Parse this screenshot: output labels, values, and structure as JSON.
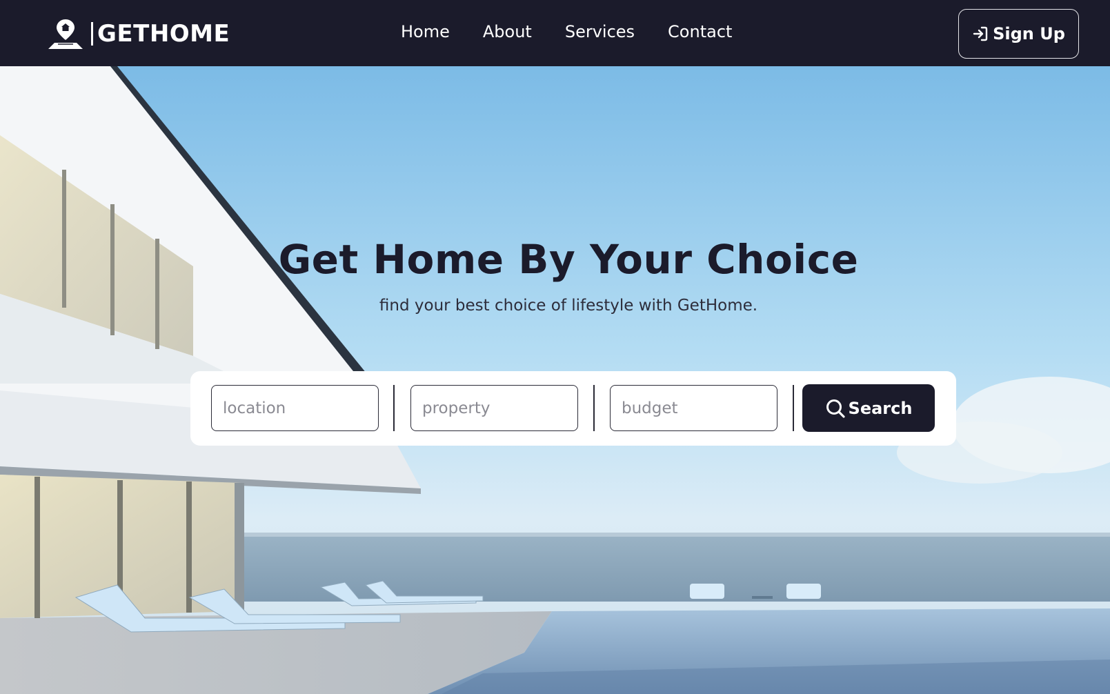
{
  "brand": {
    "name": "GETHOME",
    "logo_icon": "home-pin-icon"
  },
  "nav": {
    "links": [
      {
        "label": "Home"
      },
      {
        "label": "About"
      },
      {
        "label": "Services"
      },
      {
        "label": "Contact"
      }
    ],
    "signup": {
      "label": "Sign Up",
      "icon": "sign-in-arrow-icon"
    }
  },
  "hero": {
    "title": "Get Home By Your Choice",
    "subtitle": "find your best choice of lifestyle with GetHome."
  },
  "search": {
    "location_placeholder": "location",
    "property_placeholder": "property",
    "budget_placeholder": "budget",
    "button_label": "Search",
    "button_icon": "search-icon"
  },
  "colors": {
    "nav_bg": "#1b1b2b",
    "accent_dark": "#1b1b2b",
    "text_white": "#ffffff"
  }
}
